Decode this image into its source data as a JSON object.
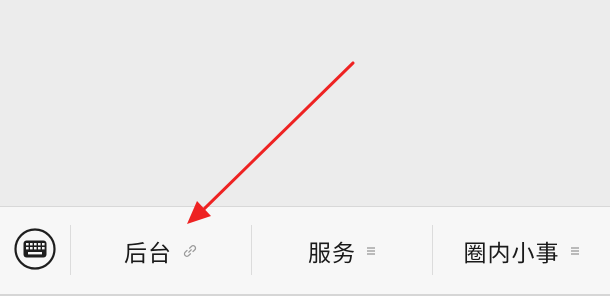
{
  "colors": {
    "background": "#ececec",
    "menu_bar": "#f7f7f7",
    "arrow": "#ee2222",
    "text": "#1a1a1a",
    "icon": "#9a9a9a"
  },
  "keyboard_toggle": {
    "icon": "keyboard-icon"
  },
  "menu": {
    "items": [
      {
        "label": "后台",
        "icon": "link-icon"
      },
      {
        "label": "服务",
        "icon": "menu-lines-icon"
      },
      {
        "label": "圈内小事",
        "icon": "menu-lines-icon"
      }
    ]
  },
  "annotation": {
    "type": "arrow",
    "target": "menu-item-houtai"
  }
}
